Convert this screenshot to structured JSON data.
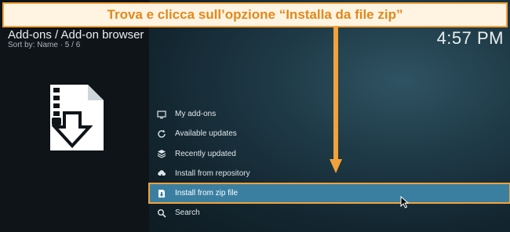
{
  "banner": {
    "text": "Trova e clicca sull’opzione “Installa da file zip”"
  },
  "header": {
    "title": "Add-ons / Add-on browser",
    "subtitle": "Sort by: Name · 5 / 6",
    "clock": "4:57 PM"
  },
  "menu": {
    "items": [
      {
        "label": "My add-ons",
        "icon": "monitor-box-icon"
      },
      {
        "label": "Available updates",
        "icon": "refresh-icon"
      },
      {
        "label": "Recently updated",
        "icon": "box-stack-icon"
      },
      {
        "label": "Install from repository",
        "icon": "cloud-download-icon"
      },
      {
        "label": "Install from zip file",
        "icon": "zip-install-icon",
        "selected": true
      },
      {
        "label": "Search",
        "icon": "search-icon"
      }
    ]
  },
  "colors": {
    "accent_orange": "#f2a23a",
    "selected_blue": "#3a7fa0",
    "banner_text": "#e0891d"
  }
}
